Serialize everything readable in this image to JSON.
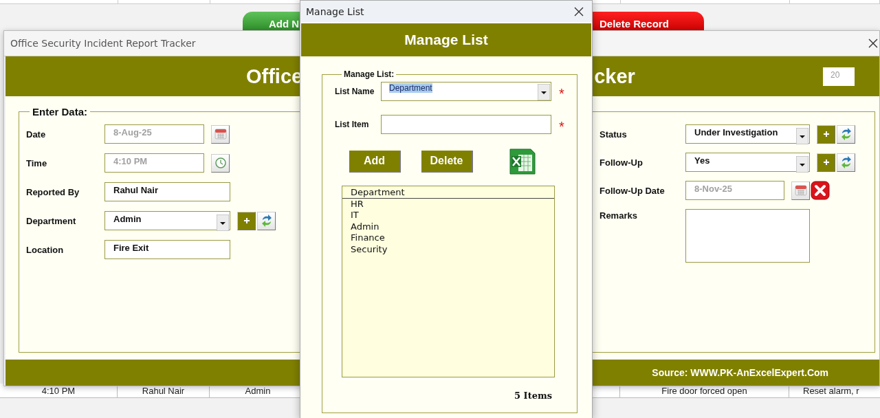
{
  "spreadsheet": {
    "buttons": [
      {
        "label": "Add N",
        "kind": "add"
      },
      {
        "label": "Delete Record",
        "kind": "delete"
      }
    ],
    "bottom_row": [
      "4:10 PM",
      "Rahul Nair",
      "Admin",
      "Fire door forced open",
      "Reset alarm, r"
    ]
  },
  "main_window": {
    "title": "Office Security Incident Report Tracker",
    "header_title_parts": [
      "Office",
      "cker"
    ],
    "record_number": "20",
    "section_title": "Enter Data:",
    "left_fields": [
      {
        "label": "Date",
        "value": "8-Aug-25",
        "kind": "date",
        "disabled": true
      },
      {
        "label": "Time",
        "value": "4:10 PM",
        "kind": "time",
        "disabled": true
      },
      {
        "label": "Reported By",
        "value": "Rahul Nair",
        "kind": "text",
        "disabled": false
      },
      {
        "label": "Department",
        "value": "Admin",
        "kind": "combo",
        "disabled": false
      },
      {
        "label": "Location",
        "value": "Fire Exit",
        "kind": "text",
        "disabled": false
      }
    ],
    "right_fields": [
      {
        "label": "Status",
        "value": "Under Investigation",
        "kind": "combo",
        "disabled": false
      },
      {
        "label": "Follow-Up",
        "value": "Yes",
        "kind": "combo",
        "disabled": false
      },
      {
        "label": "Follow-Up Date",
        "value": "8-Nov-25",
        "kind": "date_clear",
        "disabled": true
      },
      {
        "label": "Remarks",
        "kind": "textarea"
      }
    ],
    "footer": "Source: WWW.PK-AnExcelExpert.Com"
  },
  "dialog": {
    "title": "Manage List",
    "header": "Manage List",
    "group_title": "Manage List:",
    "list_name": {
      "label": "List Name",
      "value": "Department",
      "highlighted": true,
      "marker": "*"
    },
    "list_item": {
      "label": "List Item",
      "marker": "*"
    },
    "buttons": [
      "Add",
      "Delete"
    ],
    "list": {
      "column": "Department",
      "items": [
        "HR",
        "IT",
        "Admin",
        "Finance",
        "Security"
      ]
    },
    "count": "5 Items"
  }
}
